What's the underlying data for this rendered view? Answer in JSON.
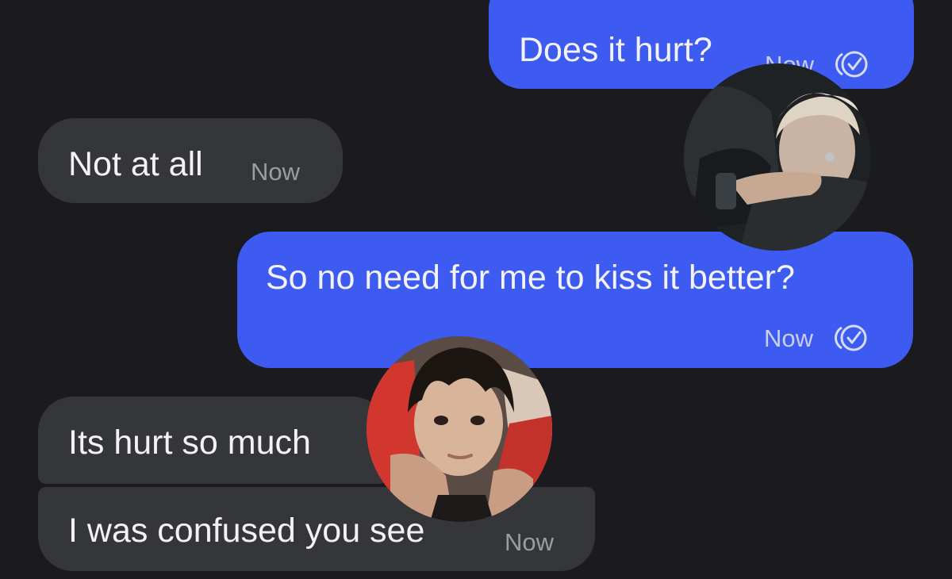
{
  "messages": [
    {
      "text": "Does it hurt?",
      "time": "Now",
      "direction": "sent",
      "read_icon": "read-receipt-icon"
    },
    {
      "text": "Not at all",
      "time": "Now",
      "direction": "received"
    },
    {
      "text": "So no need for me to kiss it better?",
      "time": "Now",
      "direction": "sent",
      "read_icon": "read-receipt-icon"
    },
    {
      "text": "Its hurt so much",
      "direction": "received"
    },
    {
      "text": "I was confused you see",
      "time": "Now",
      "direction": "received"
    }
  ],
  "colors": {
    "background": "#1b1b1f",
    "sent_bubble": "#3d5af1",
    "received_bubble": "#34363a",
    "text": "#f2f2f4",
    "sent_meta": "#c9cfe8",
    "received_meta": "#9a9ca2"
  },
  "avatars": [
    {
      "name": "avatar-blonde-person",
      "icon": "person-photo"
    },
    {
      "name": "avatar-dark-hair-person",
      "icon": "person-photo"
    }
  ]
}
